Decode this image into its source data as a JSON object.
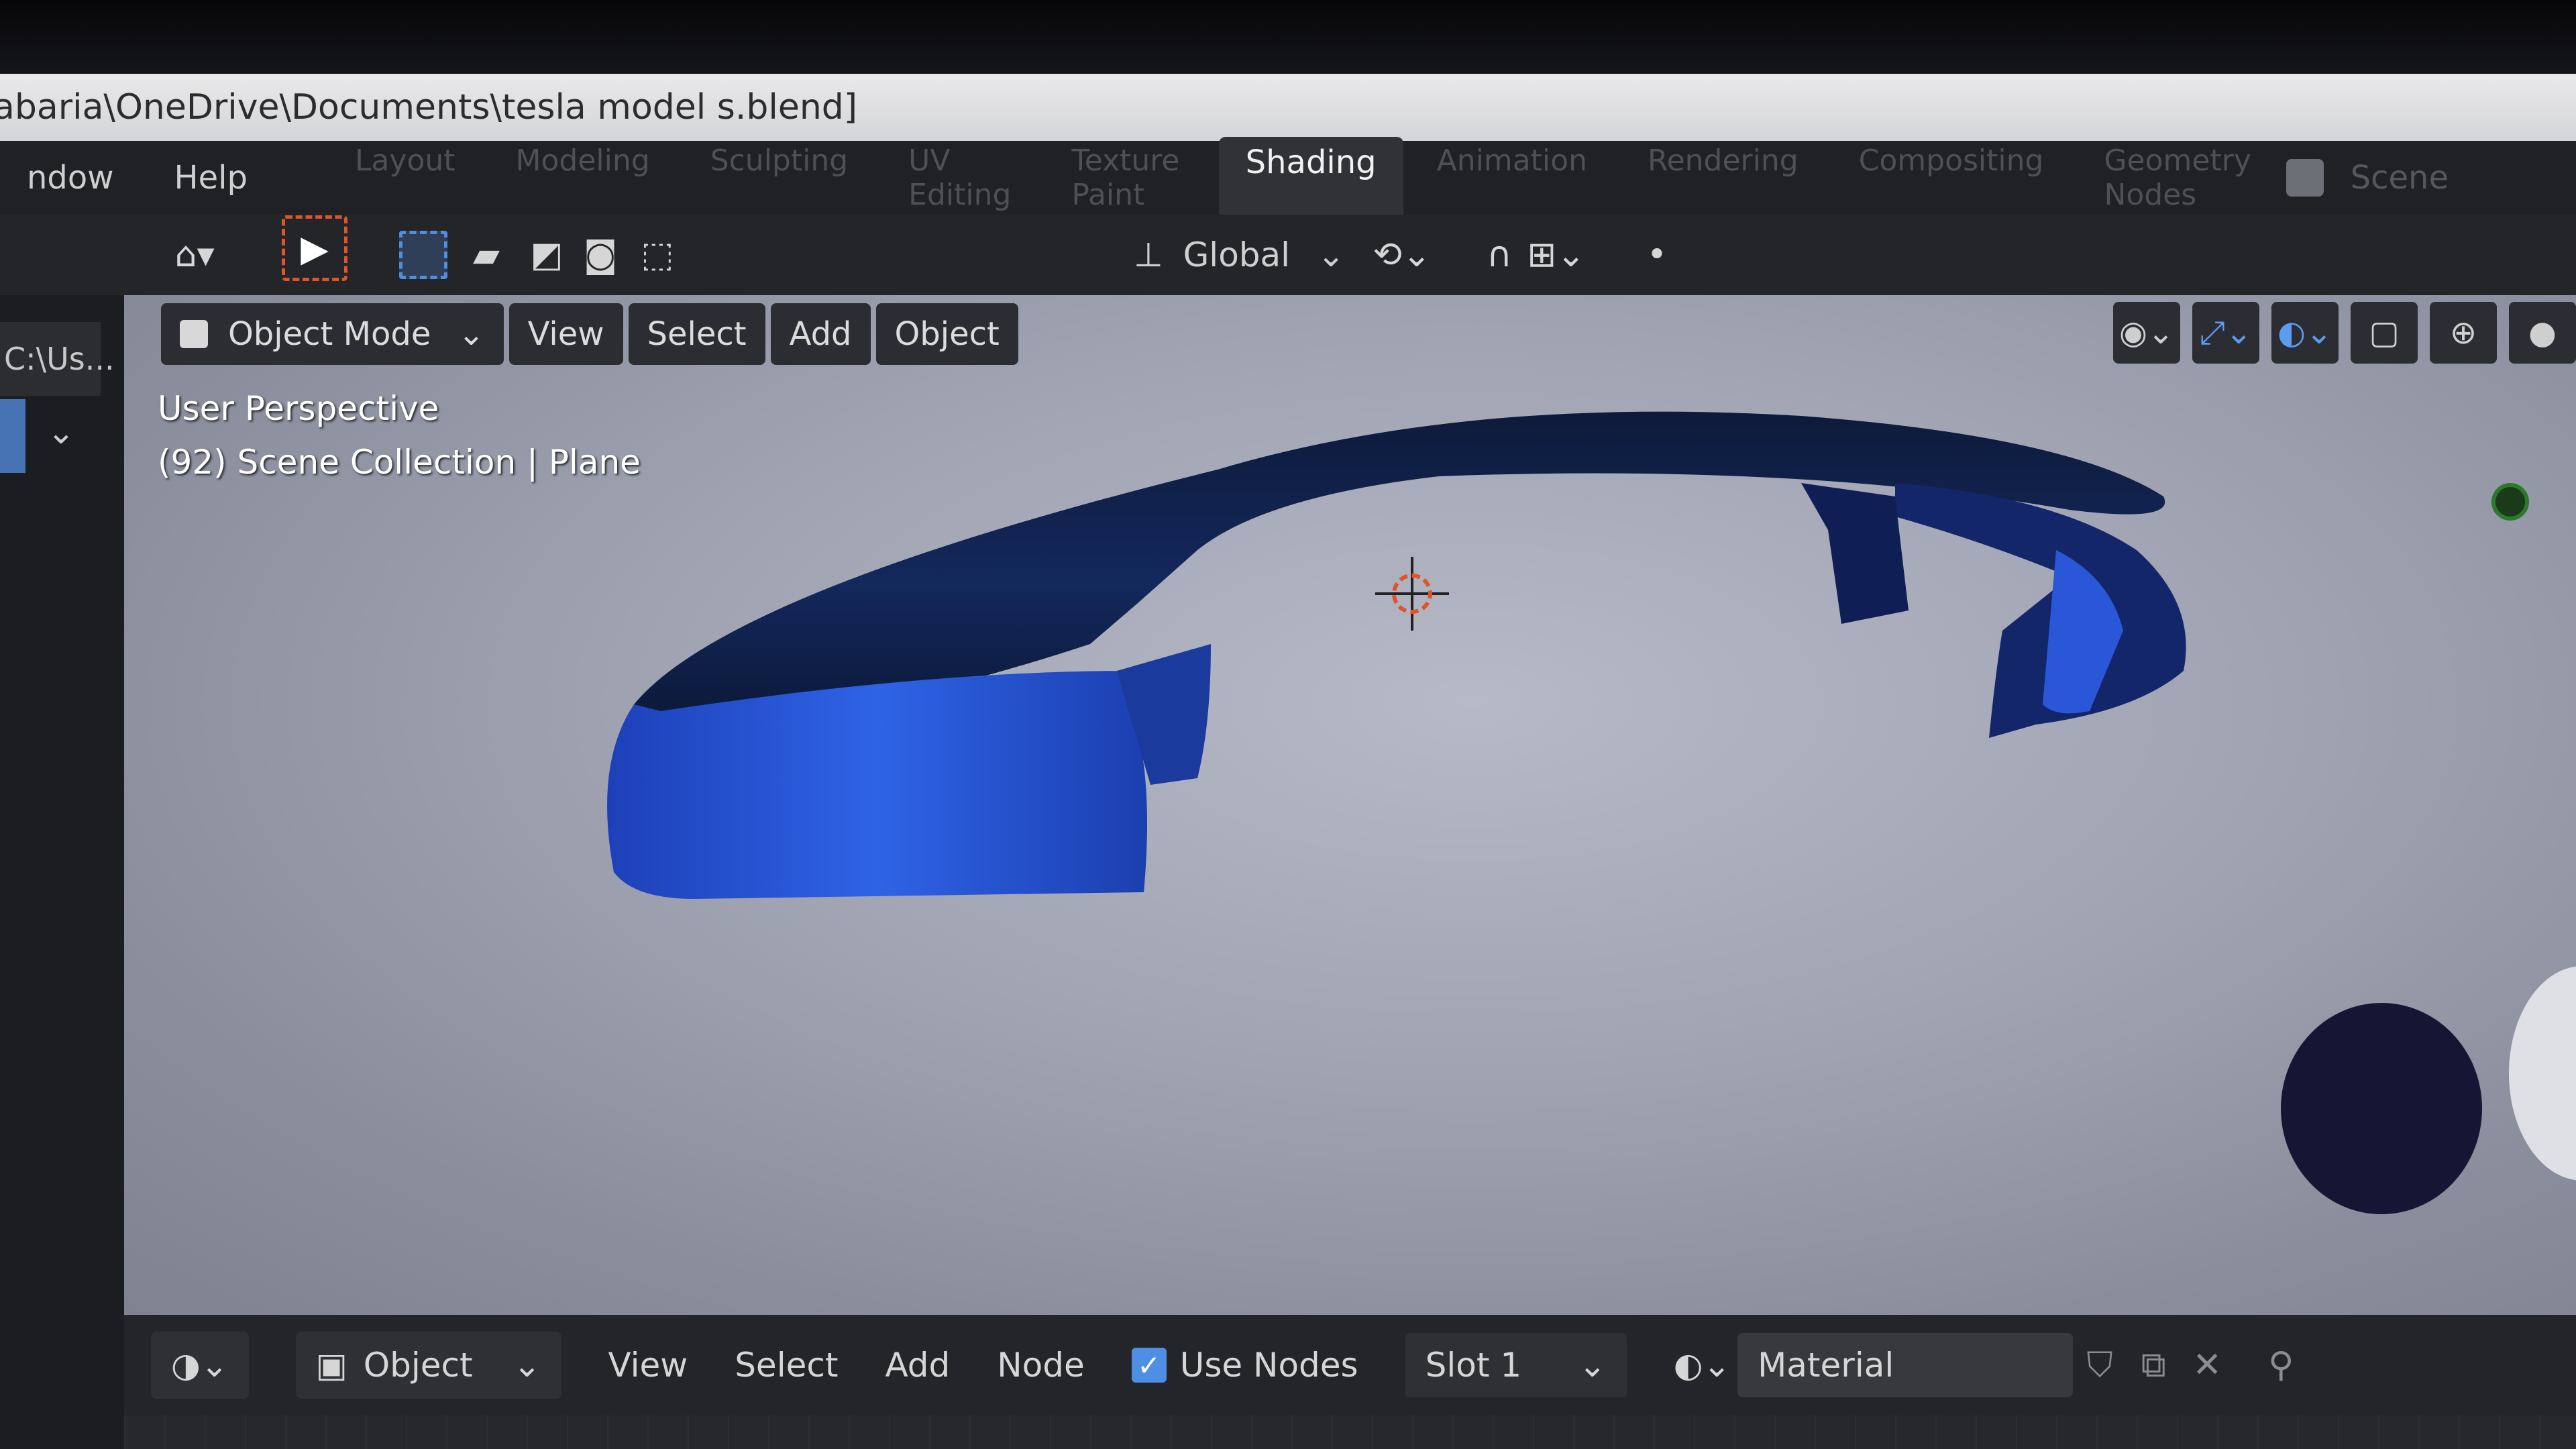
{
  "window": {
    "title_path": "abaria\\OneDrive\\Documents\\tesla model s.blend]"
  },
  "menu": {
    "items": [
      "ndow",
      "Help"
    ]
  },
  "workspaces": {
    "tabs": [
      "Layout",
      "Modeling",
      "Sculpting",
      "UV Editing",
      "Texture Paint",
      "Shading",
      "Animation",
      "Rendering",
      "Compositing",
      "Geometry Nodes"
    ],
    "active": "Shading"
  },
  "scene": {
    "label": "Scene"
  },
  "tool_header": {
    "orientation": "Global"
  },
  "left_panel": {
    "tab_label": "C:\\Us..."
  },
  "viewport": {
    "mode": "Object Mode",
    "menus": [
      "View",
      "Select",
      "Add",
      "Object"
    ],
    "info_line1": "User Perspective",
    "info_line2": "(92) Scene Collection | Plane"
  },
  "node_editor": {
    "editor_type": "Object",
    "menus": [
      "View",
      "Select",
      "Add",
      "Node"
    ],
    "use_nodes_label": "Use Nodes",
    "use_nodes_checked": true,
    "slot": "Slot 1",
    "material": "Material"
  },
  "colors": {
    "accent_blue": "#4f8fe3",
    "model_blue": "#1f4fd0",
    "cursor_red": "#e0532b"
  }
}
